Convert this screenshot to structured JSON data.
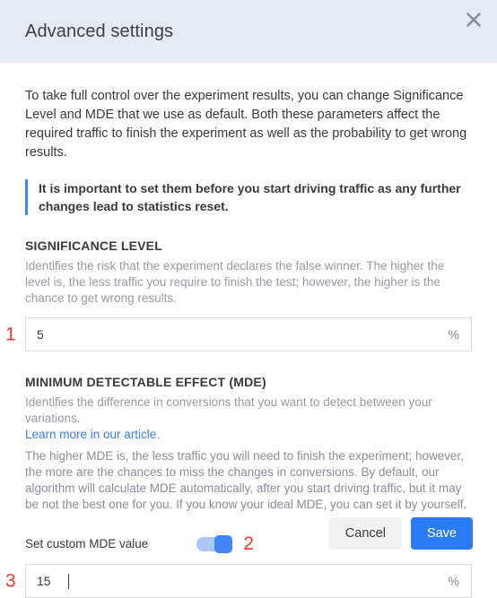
{
  "dialog": {
    "title": "Advanced settings",
    "close_icon": "close-icon",
    "intro": "To take full control over the experiment results, you can change Significance Level and MDE that we use as default. Both these parameters affect the required traffic to finish the experiment as well as the probability to get wrong results.",
    "callout": "It is important to set them before you start driving traffic as any further changes lead to statistics reset."
  },
  "significance": {
    "heading": "SIGNIFICANCE LEVEL",
    "description": "Identifies the risk that the experiment declares the false winner. The higher the level is, the less traffic you require to finish the test; however, the higher is the chance to get wrong results.",
    "marker": "1",
    "value": "5",
    "placeholder": "",
    "suffix": "%"
  },
  "mde": {
    "heading": "MINIMUM DETECTABLE EFFECT (MDE)",
    "description": "Identifies the difference in conversions that you want to detect between your variations.",
    "link_text": "Learn more in our article",
    "link_suffix": ".",
    "long_description": "The higher MDE is, the less traffic you will need to finish the experiment; however, the more are the chances to miss the changes in conversions. By default, our algorithm will calculate MDE automatically, after you start driving traffic, but it may be not the best one for you. If you know your ideal MDE, you can set it by yourself.",
    "toggle_label": "Set custom MDE value",
    "toggle_state": "on",
    "toggle_marker": "2",
    "marker": "3",
    "value": "15",
    "placeholder": "",
    "suffix": "%"
  },
  "footer": {
    "cancel_label": "Cancel",
    "save_label": "Save"
  },
  "colors": {
    "header_bg": "#e6eaf2",
    "accent_blue": "#4285f4",
    "save_blue": "#2b7cf7",
    "marker_red": "#ef3b2d",
    "link_blue": "#3b7ddd"
  }
}
